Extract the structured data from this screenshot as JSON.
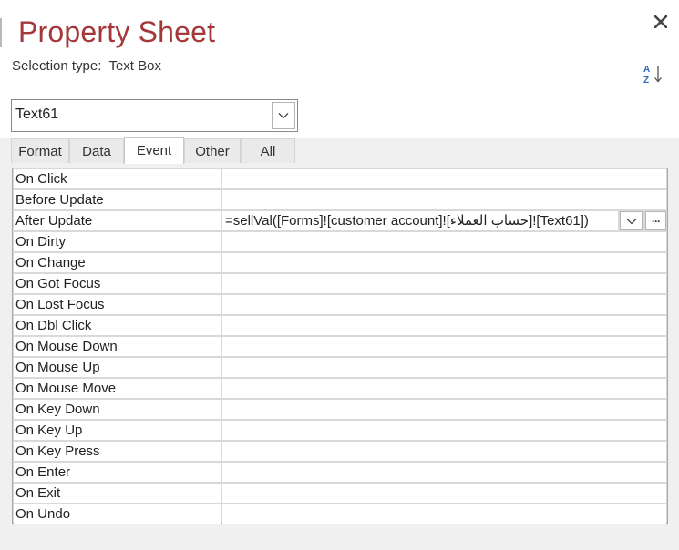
{
  "header": {
    "title": "Property Sheet",
    "selection_type": "Selection type:  Text Box"
  },
  "icons": {
    "close": "close-icon",
    "sort": "sort-az-icon",
    "dropdown": "chevron-down-icon",
    "builder": "ellipsis-icon"
  },
  "colors": {
    "title": "#a4373a",
    "sort_icon": "#2b6cb0"
  },
  "selector": {
    "value": "Text61"
  },
  "tabs": [
    {
      "label": "Format",
      "active": false
    },
    {
      "label": "Data",
      "active": false
    },
    {
      "label": "Event",
      "active": true
    },
    {
      "label": "Other",
      "active": false
    },
    {
      "label": "All",
      "active": false
    }
  ],
  "properties": [
    {
      "label": "On Click",
      "value": ""
    },
    {
      "label": "Before Update",
      "value": ""
    },
    {
      "label": "After Update",
      "value": "=sellVal([Forms]![customer account]![حساب العملاء]![Text61])"
    },
    {
      "label": "On Dirty",
      "value": ""
    },
    {
      "label": "On Change",
      "value": ""
    },
    {
      "label": "On Got Focus",
      "value": ""
    },
    {
      "label": "On Lost Focus",
      "value": ""
    },
    {
      "label": "On Dbl Click",
      "value": ""
    },
    {
      "label": "On Mouse Down",
      "value": ""
    },
    {
      "label": "On Mouse Up",
      "value": ""
    },
    {
      "label": "On Mouse Move",
      "value": ""
    },
    {
      "label": "On Key Down",
      "value": ""
    },
    {
      "label": "On Key Up",
      "value": ""
    },
    {
      "label": "On Key Press",
      "value": ""
    },
    {
      "label": "On Enter",
      "value": ""
    },
    {
      "label": "On Exit",
      "value": ""
    },
    {
      "label": "On Undo",
      "value": ""
    }
  ]
}
